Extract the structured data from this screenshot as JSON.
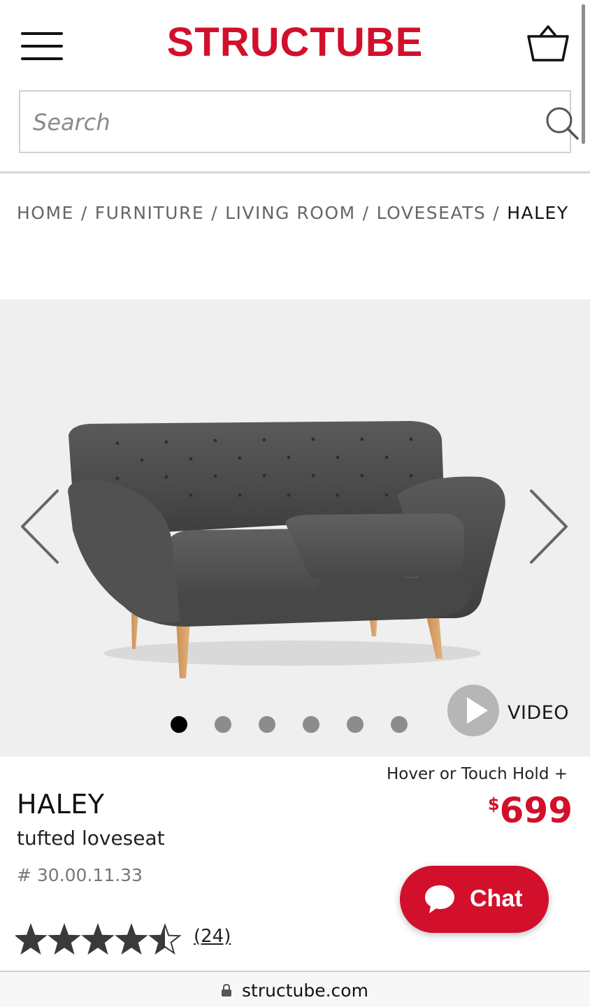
{
  "header": {
    "logo": "STRUCTUBE",
    "menu_icon": "hamburger-menu-icon",
    "cart_icon": "shopping-basket-icon",
    "search_placeholder": "Search",
    "search_icon": "search-icon"
  },
  "breadcrumb": {
    "items": [
      "HOME",
      "FURNITURE",
      "LIVING ROOM",
      "LOVESEATS"
    ],
    "separator": "/",
    "current": "HALEY"
  },
  "gallery": {
    "slide_count": 6,
    "active_slide": 1,
    "video_label": "VIDEO",
    "prev_icon": "chevron-left-icon",
    "next_icon": "chevron-right-icon",
    "play_icon": "play-icon"
  },
  "product": {
    "name": "HALEY",
    "subtitle": "tufted loveseat",
    "sku": "# 30.00.11.33",
    "hover_hint": "Hover or Touch Hold +",
    "price_currency": "$",
    "price_amount": "699",
    "rating": 4.5,
    "rating_max": 5,
    "review_count": "(24)"
  },
  "chat": {
    "label": "Chat",
    "icon": "chat-bubble-icon"
  },
  "browser": {
    "url": "structube.com",
    "lock_icon": "lock-icon"
  },
  "colors": {
    "brand_red": "#d2102b",
    "gallery_bg": "#efefef",
    "active_dot": "#000000",
    "inactive_dot": "#8c8c8c"
  }
}
